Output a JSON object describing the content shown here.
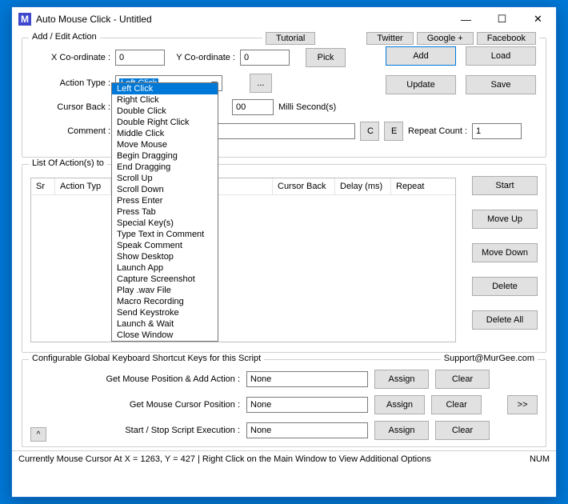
{
  "window": {
    "app_letter": "M",
    "title": "Auto Mouse Click - Untitled"
  },
  "links": {
    "tutorial": "Tutorial",
    "twitter": "Twitter",
    "google": "Google +",
    "facebook": "Facebook"
  },
  "groupbox1": {
    "legend": "Add / Edit Action",
    "x_label": "X Co-ordinate :",
    "x_value": "0",
    "y_label": "Y Co-ordinate :",
    "y_value": "0",
    "pick": "Pick",
    "action_type_label": "Action Type :",
    "action_type_value": "Left Click",
    "dots": "...",
    "cursor_back_label": "Cursor Back :",
    "delay_label": "",
    "delay_value": "00",
    "delay_unit": "Milli Second(s)",
    "comment_label": "Comment :",
    "comment_value": "",
    "c_btn": "C",
    "e_btn": "E",
    "repeat_label": "Repeat Count :",
    "repeat_value": "1"
  },
  "rightcol": {
    "add": "Add",
    "load": "Load",
    "update": "Update",
    "save": "Save"
  },
  "dropdown": {
    "selected": "Left Click",
    "options": [
      "Left Click",
      "Right Click",
      "Double Click",
      "Double Right Click",
      "Middle Click",
      "Move Mouse",
      "Begin Dragging",
      "End Dragging",
      "Scroll Up",
      "Scroll Down",
      "Press Enter",
      "Press Tab",
      "Special Key(s)",
      "Type Text in Comment",
      "Speak Comment",
      "Show Desktop",
      "Launch App",
      "Capture Screenshot",
      "Play .wav File",
      "Macro Recording",
      "Send Keystroke",
      "Launch & Wait",
      "Close Window"
    ]
  },
  "table": {
    "caption": "List Of Action(s) to",
    "cols": [
      "Sr",
      "Action Typ",
      "",
      "",
      "Cursor Back",
      "Delay (ms)",
      "Repeat"
    ]
  },
  "side": {
    "start": "Start",
    "moveup": "Move Up",
    "movedown": "Move Down",
    "delete": "Delete",
    "deleteall": "Delete All"
  },
  "shortcuts": {
    "legend": "Configurable Global Keyboard Shortcut Keys for this Script",
    "support": "Support@MurGee.com",
    "row1_label": "Get Mouse Position & Add Action :",
    "row2_label": "Get Mouse Cursor Position :",
    "row3_label": "Start / Stop Script Execution :",
    "none": "None",
    "assign": "Assign",
    "clear": "Clear",
    "more": ">>",
    "caret": "^"
  },
  "status": {
    "text": "Currently Mouse Cursor At X = 1263, Y = 427 | Right Click on the Main Window to View Additional Options",
    "num": "NUM"
  }
}
